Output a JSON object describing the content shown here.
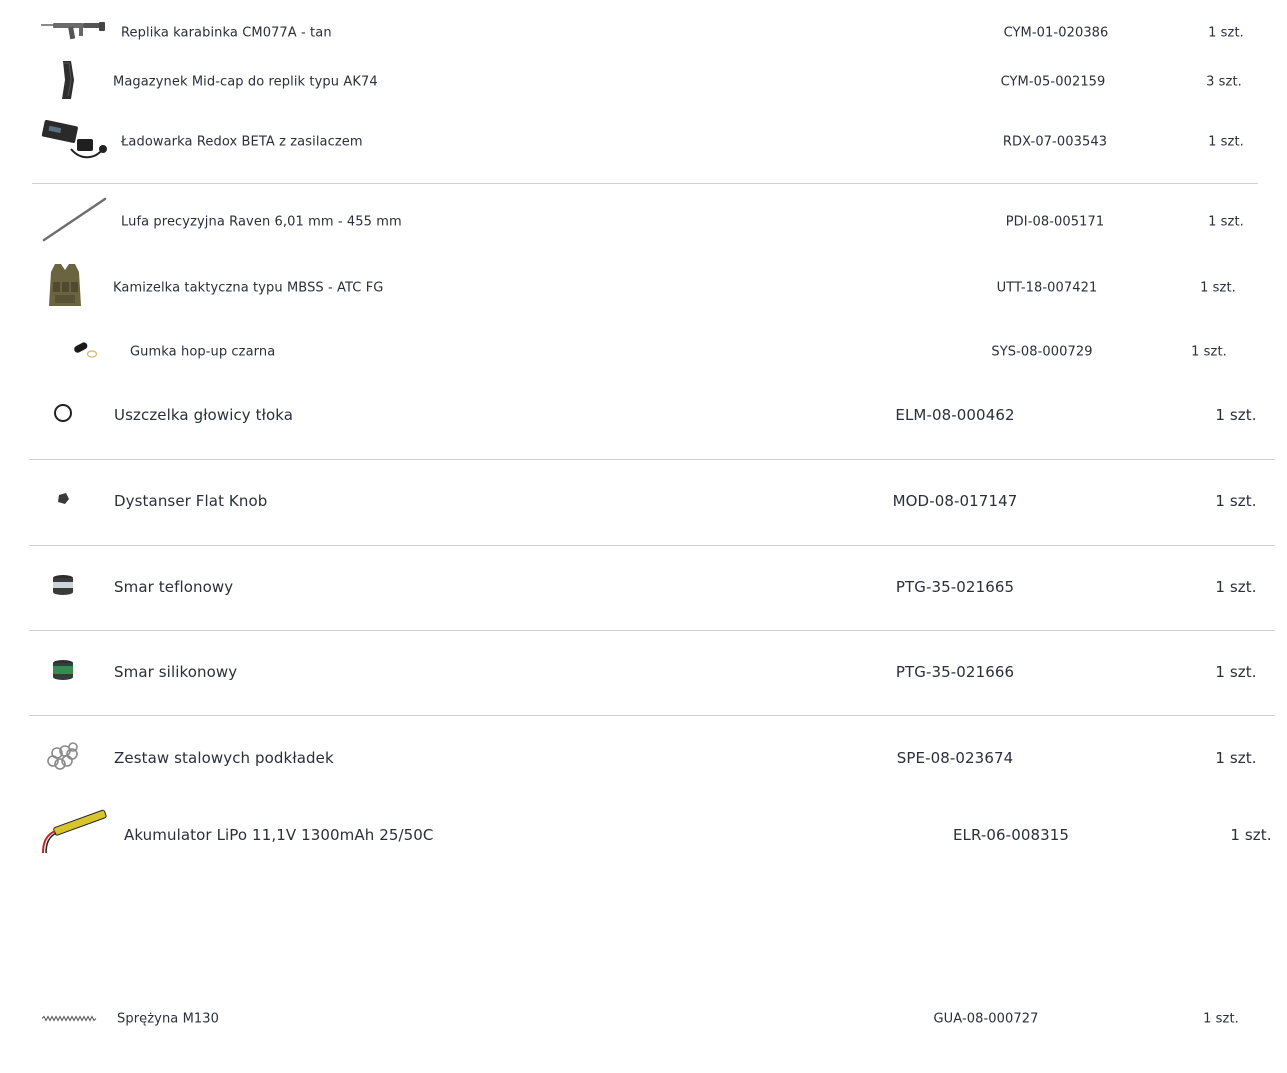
{
  "items": [
    {
      "name": "Replika karabinka CM077A - tan",
      "sku": "CYM-01-020386",
      "qty": "1 szt.",
      "icon": "rifle-icon"
    },
    {
      "name": "Magazynek Mid-cap do replik typu AK74",
      "sku": "CYM-05-002159",
      "qty": "3 szt.",
      "icon": "magazine-icon"
    },
    {
      "name": "Ładowarka Redox BETA z zasilaczem",
      "sku": "RDX-07-003543",
      "qty": "1 szt.",
      "icon": "charger-icon"
    },
    {
      "name": "Lufa precyzyjna Raven 6,01 mm - 455 mm",
      "sku": "PDI-08-005171",
      "qty": "1 szt.",
      "icon": "barrel-icon"
    },
    {
      "name": "Kamizelka taktyczna typu MBSS - ATC FG",
      "sku": "UTT-18-007421",
      "qty": "1 szt.",
      "icon": "vest-icon"
    },
    {
      "name": "Gumka hop-up czarna",
      "sku": "SYS-08-000729",
      "qty": "1 szt.",
      "icon": "hopup-rubber-icon"
    },
    {
      "name": "Uszczelka głowicy tłoka",
      "sku": "ELM-08-000462",
      "qty": "1 szt.",
      "icon": "o-ring-icon"
    },
    {
      "name": "Dystanser Flat Knob",
      "sku": "MOD-08-017147",
      "qty": "1 szt.",
      "icon": "spacer-icon"
    },
    {
      "name": "Smar teflonowy",
      "sku": "PTG-35-021665",
      "qty": "1 szt.",
      "icon": "grease-jar-icon"
    },
    {
      "name": "Smar silikonowy",
      "sku": "PTG-35-021666",
      "qty": "1 szt.",
      "icon": "grease-jar-green-icon"
    },
    {
      "name": "Zestaw stalowych podkładek",
      "sku": "SPE-08-023674",
      "qty": "1 szt.",
      "icon": "washers-icon"
    },
    {
      "name": "Akumulator LiPo 11,1V 1300mAh 25/50C",
      "sku": "ELR-06-008315",
      "qty": "1 szt.",
      "icon": "battery-icon"
    },
    {
      "name": "Sprężyna M130",
      "sku": "GUA-08-000727",
      "qty": "1 szt.",
      "icon": "spring-icon"
    }
  ],
  "colors": {
    "text": "#2b2f3a",
    "divider": "#d0d0d0"
  }
}
